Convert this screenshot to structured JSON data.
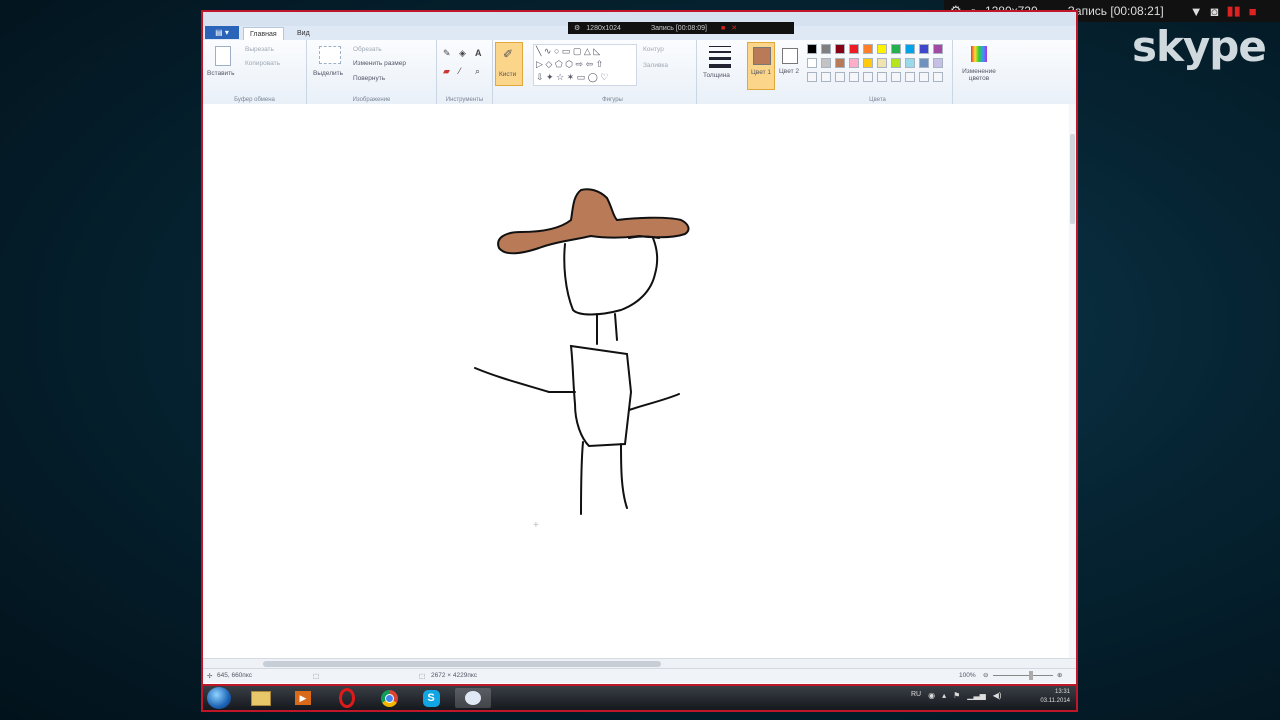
{
  "recorder": {
    "resolution": "1280x720",
    "record_label": "Запись [00:08:21]"
  },
  "skype_logo": "skype",
  "mini_recorder": {
    "resolution": "1280x1024",
    "record_label": "Запись [00:08:09]"
  },
  "paint": {
    "tabs": [
      "Главная",
      "Вид"
    ],
    "clipboard": {
      "paste": "Вставить",
      "cut": "Вырезать",
      "copy": "Копировать",
      "label": "Буфер обмена"
    },
    "image": {
      "select": "Выделить",
      "crop": "Обрезать",
      "resize": "Изменить размер",
      "rotate": "Повернуть",
      "label": "Изображение"
    },
    "tools_label": "Инструменты",
    "brushes": "Кисти",
    "shapes": {
      "outline": "Контур",
      "fill": "Заливка",
      "label": "Фигуры"
    },
    "size": "Толщина",
    "color1": "Цвет 1",
    "color2": "Цвет 2",
    "colors_label": "Цвета",
    "edit_colors": "Изменение цветов",
    "palette_top": [
      "#000000",
      "#7f7f7f",
      "#880015",
      "#ed1c24",
      "#ff7f27",
      "#fff200",
      "#22b14c",
      "#00a2e8",
      "#3f48cc",
      "#a349a4"
    ],
    "palette_bottom": [
      "#ffffff",
      "#c3c3c3",
      "#b97a57",
      "#ffaec9",
      "#ffc90e",
      "#efe4b0",
      "#b5e61d",
      "#99d9ea",
      "#7092be",
      "#c8bfe7"
    ],
    "color1_value": "#b97a57",
    "hat_color": "#b97a57",
    "status": {
      "position": "645, 660пкс",
      "size": "2672 × 4229пкс",
      "zoom": "100%"
    }
  },
  "taskbar": {
    "lang": "RU",
    "time": "13:31",
    "date": "03.11.2014"
  }
}
